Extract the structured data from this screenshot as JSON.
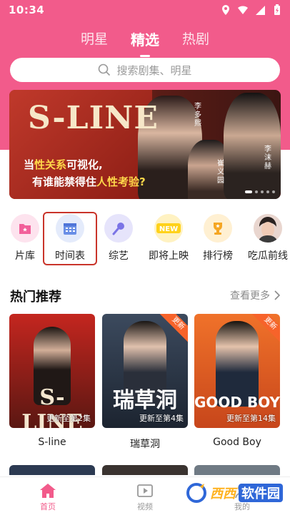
{
  "status": {
    "time": "10:34"
  },
  "tabs": [
    {
      "label": "明星",
      "active": false
    },
    {
      "label": "精选",
      "active": true
    },
    {
      "label": "热剧",
      "active": false
    }
  ],
  "search": {
    "placeholder": "搜索剧集、明星"
  },
  "banner": {
    "logo": "S-LINE",
    "line1_a": "当",
    "line1_b": "性关系",
    "line1_c": "可视化,",
    "line2_a": "有谁能禁得住",
    "line2_b": "人性考验?",
    "names": [
      "李多熙",
      "崔义园",
      "李沫赫"
    ]
  },
  "quick_entries": [
    {
      "label": "片库",
      "icon": "bookmark-icon",
      "color": "#fde3ee"
    },
    {
      "label": "时间表",
      "icon": "calendar-icon",
      "color": "#e4ebfb"
    },
    {
      "label": "综艺",
      "icon": "microphone-icon",
      "color": "#e6e4fb"
    },
    {
      "label": "即将上映",
      "icon": "new-badge-icon",
      "color": "#fff2c2"
    },
    {
      "label": "排行榜",
      "icon": "trophy-icon",
      "color": "#fff0d2"
    },
    {
      "label": "吃瓜前线",
      "icon": "avatar",
      "color": "#f1e6e2"
    }
  ],
  "hot": {
    "title": "热门推荐",
    "see_more": "查看更多",
    "cards": [
      {
        "title": "S-line",
        "ep": "更新至第2集",
        "poster_text": "S-LINE",
        "colors": [
          "#c4261f",
          "#5a1712"
        ],
        "corner": ""
      },
      {
        "title": "瑞草洞",
        "ep": "更新至第4集",
        "poster_text": "瑞草洞",
        "colors": [
          "#2f3b4d",
          "#1c2430"
        ],
        "corner": "更新"
      },
      {
        "title": "Good Boy",
        "ep": "更新至第14集",
        "poster_text": "GOOD BOY",
        "colors": [
          "#f0722a",
          "#c7461b"
        ],
        "corner": "更新"
      }
    ]
  },
  "bottom_nav": [
    {
      "label": "首页",
      "icon": "home-icon",
      "active": true
    },
    {
      "label": "视频",
      "icon": "play-icon",
      "active": false
    },
    {
      "label": "我的",
      "icon": "user-icon",
      "active": false
    }
  ],
  "watermark": {
    "text_a": "西西",
    "text_b": "软件园"
  }
}
